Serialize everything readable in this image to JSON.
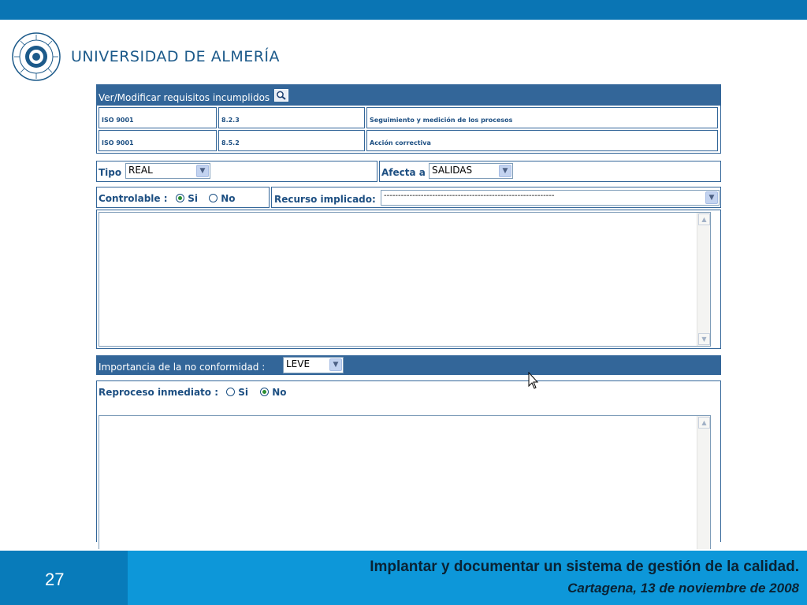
{
  "branding": {
    "university_name": "UNIVERSIDAD DE ALMERÍA",
    "seal_text": "IN LUMINE SAPIENTIA · UNIVERSITAS ALMERIENSIS"
  },
  "requirements": {
    "header_label": "Ver/Modificar requisitos incumplidos",
    "rows": [
      {
        "norm": "ISO 9001",
        "clause": "8.2.3",
        "description": "Seguimiento y medición de los procesos"
      },
      {
        "norm": "ISO 9001",
        "clause": "8.5.2",
        "description": "Acción correctiva"
      }
    ]
  },
  "tipo": {
    "label": "Tipo",
    "value": "REAL"
  },
  "afecta": {
    "label": "Afecta a",
    "value": "SALIDAS"
  },
  "controlable": {
    "label": "Controlable :",
    "si": "Si",
    "no": "No",
    "selected": "Si"
  },
  "recurso": {
    "label": "Recurso implicado:",
    "value": "------------------------------------------------------------"
  },
  "importancia": {
    "label": "Importancia de la no conformidad :",
    "value": "LEVE"
  },
  "reproceso": {
    "label": "Reproceso inmediato :",
    "si": "Si",
    "no": "No",
    "selected": "No"
  },
  "icons": {
    "search": "magnifier-icon",
    "dropdown": "chevron-down-icon",
    "cursor": "mouse-pointer-icon"
  },
  "colors": {
    "top_bar": "#0a75b4",
    "header_bar": "#336699",
    "footer": "#0d97d9",
    "footer_left": "#087bba",
    "label_text": "#1d4f82"
  },
  "footer": {
    "slide_number": "27",
    "title": "Implantar y documentar un sistema de gestión de la calidad.",
    "subtitle": "Cartagena, 13 de noviembre de 2008"
  }
}
